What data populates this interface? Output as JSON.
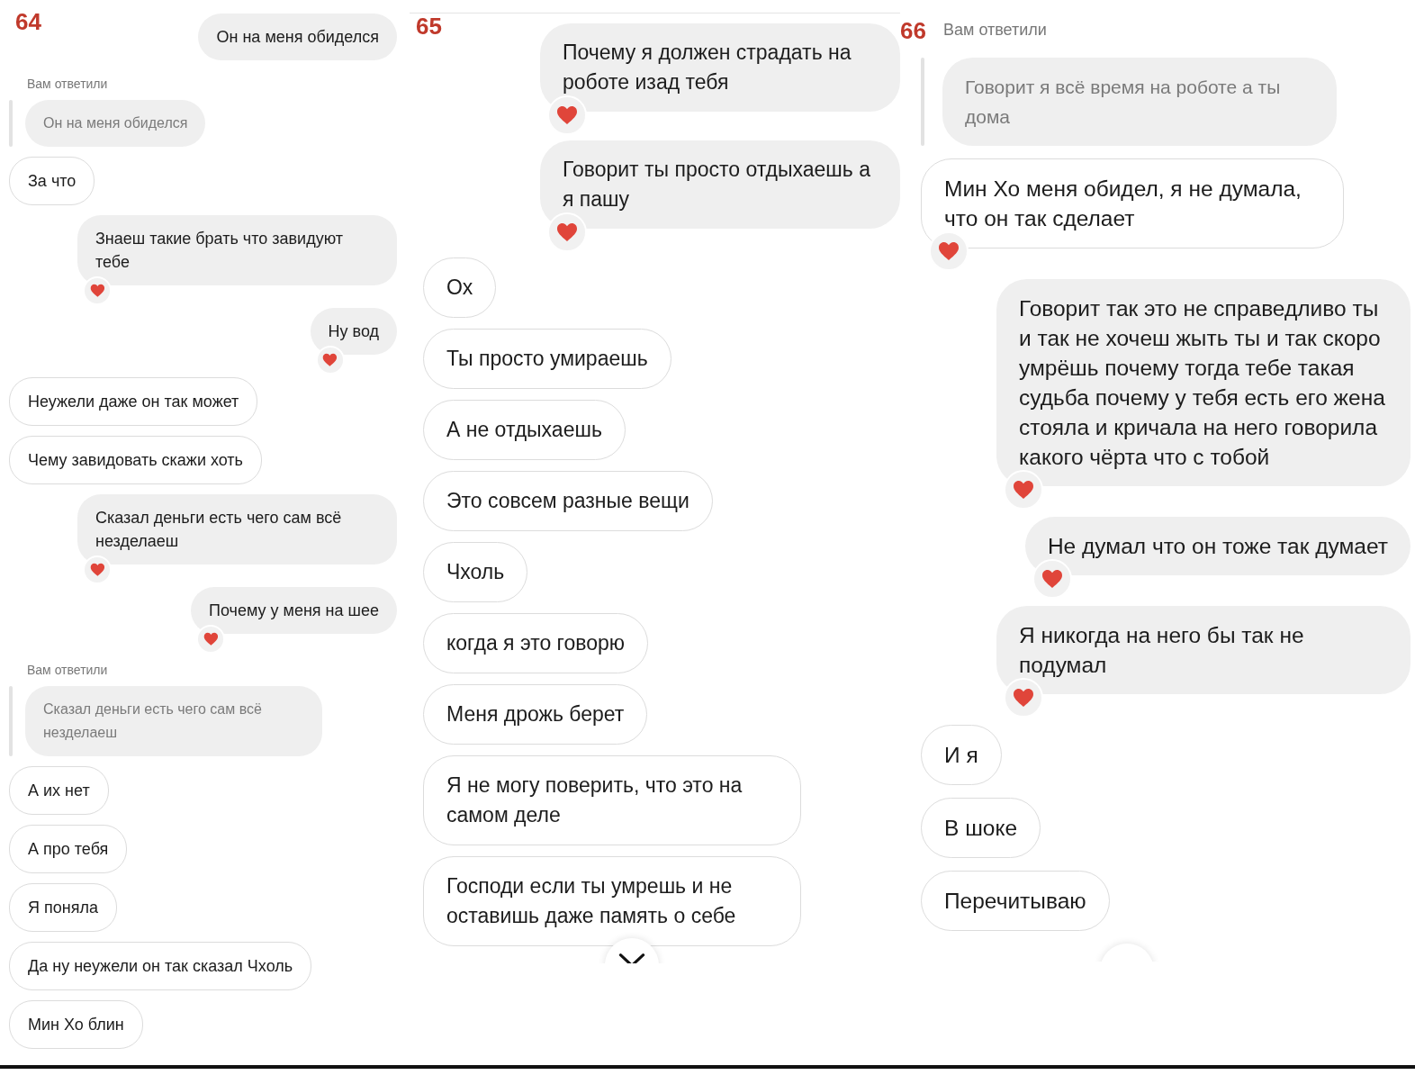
{
  "pages": [
    {
      "number": "64",
      "messages": [
        {
          "kind": "sent",
          "text": "Он на меня обиделся",
          "reaction": false
        },
        {
          "kind": "reply_label",
          "text": "Вам ответили"
        },
        {
          "kind": "quoted",
          "text": "Он на меня обиделся"
        },
        {
          "kind": "received",
          "text": "За что",
          "reaction": false
        },
        {
          "kind": "sent",
          "text": "Знаеш такие брать что завидуют тебе",
          "reaction": true
        },
        {
          "kind": "sent",
          "text": "Ну вод",
          "reaction": true
        },
        {
          "kind": "received",
          "text": "Неужели даже он так может",
          "reaction": false
        },
        {
          "kind": "received",
          "text": "Чему завидовать скажи хоть",
          "reaction": false
        },
        {
          "kind": "sent",
          "text": "Сказал деньги есть чего сам всё незделаеш",
          "reaction": true
        },
        {
          "kind": "sent",
          "text": "Почему у меня на шее",
          "reaction": true
        },
        {
          "kind": "reply_label",
          "text": "Вам ответили"
        },
        {
          "kind": "quoted",
          "text": "Сказал деньги есть чего сам всё незделаеш"
        },
        {
          "kind": "received",
          "text": "А их нет",
          "reaction": false
        },
        {
          "kind": "received",
          "text": "А про тебя",
          "reaction": false
        },
        {
          "kind": "received",
          "text": "Я поняла",
          "reaction": false
        },
        {
          "kind": "received",
          "text": "Да ну неужели он так сказал Чхоль",
          "reaction": false
        },
        {
          "kind": "received",
          "text": "Мин Хо блин",
          "reaction": false
        }
      ]
    },
    {
      "number": "65",
      "scroll_button": {
        "kind": "chevron"
      },
      "messages": [
        {
          "kind": "sent",
          "text": "Почему я должен страдать на роботе изад тебя",
          "reaction": true
        },
        {
          "kind": "sent",
          "text": "Говорит ты просто отдыхаешь а я пашу",
          "reaction": true
        },
        {
          "kind": "received",
          "text": "Ох",
          "reaction": false
        },
        {
          "kind": "received",
          "text": "Ты просто умираешь",
          "reaction": false
        },
        {
          "kind": "received",
          "text": "А не отдыхаешь",
          "reaction": false
        },
        {
          "kind": "received",
          "text": "Это совсем разные вещи",
          "reaction": false
        },
        {
          "kind": "received",
          "text": "Чхоль",
          "reaction": false
        },
        {
          "kind": "received",
          "text": "когда я это говорю",
          "reaction": false
        },
        {
          "kind": "received",
          "text": "Меня дрожь берет",
          "reaction": false
        },
        {
          "kind": "received",
          "text": "Я не могу поверить, что это на самом деле",
          "reaction": false
        },
        {
          "kind": "received",
          "text": "Господи если ты умрешь и не оставишь даже память о себе",
          "reaction": false
        }
      ]
    },
    {
      "number": "66",
      "scroll_button": {
        "kind": "blank"
      },
      "messages": [
        {
          "kind": "reply_label",
          "text": "Вам ответили"
        },
        {
          "kind": "quoted",
          "text": "Говорит я всё время на роботе а ты дома"
        },
        {
          "kind": "received",
          "text": "Мин Хо меня обидел, я не думала, что он так сделает",
          "reaction": true
        },
        {
          "kind": "sent",
          "text": "Говорит так это не справедливо ты и так не хочеш жыть ты и так скоро умрёшь почему тогда тебе такая судьба почему у тебя есть его жена стояла и кричала на него говорила какого чёрта что с тобой",
          "reaction": true
        },
        {
          "kind": "sent",
          "text": "Не думал что он тоже так думает",
          "reaction": true
        },
        {
          "kind": "sent",
          "text": "Я никогда на него бы так не подумал",
          "reaction": true
        },
        {
          "kind": "received",
          "text": "И я",
          "reaction": false
        },
        {
          "kind": "received",
          "text": "В шоке",
          "reaction": false
        },
        {
          "kind": "received",
          "text": "Перечитываю",
          "reaction": false
        }
      ]
    }
  ]
}
